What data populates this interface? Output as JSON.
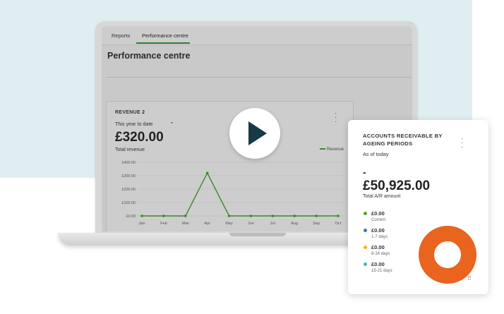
{
  "tabs": [
    {
      "label": "Reports"
    },
    {
      "label": "Performance centre",
      "active": true
    }
  ],
  "page_title": "Performance centre",
  "revenue_card": {
    "label": "REVENUE 2",
    "period": "This year to date",
    "amount": "£320.00",
    "subtitle": "Total revenue",
    "legend": "Revenue",
    "series_color": "#3a8a2a"
  },
  "chart_data": {
    "type": "line",
    "categories": [
      "Jan",
      "Feb",
      "Mar",
      "Apr",
      "May",
      "Jun",
      "Jul",
      "Aug",
      "Sep",
      "Oct"
    ],
    "series": [
      {
        "name": "Revenue",
        "values": [
          0,
          0,
          0,
          320,
          0,
          0,
          0,
          0,
          0,
          0
        ]
      }
    ],
    "y_ticks": [
      "£400.00",
      "£300.00",
      "£200.00",
      "£100.00",
      "£0.00"
    ],
    "ylim": [
      0,
      400
    ],
    "grid": true,
    "legend_position": "top-right"
  },
  "play_button": {
    "icon": "play-icon"
  },
  "ar_card": {
    "title": "ACCOUNTS RECEIVABLE BY AGEING PERIODS",
    "as_of": "As of today",
    "dash": "-",
    "amount": "£50,925.00",
    "subtitle": "Total A/R amount",
    "items": [
      {
        "value": "£0.00",
        "period": "Current",
        "color": "#5aa02c"
      },
      {
        "value": "£0.00",
        "period": "1-7 days",
        "color": "#2f7dc3"
      },
      {
        "value": "£0.00",
        "period": "8-14 days",
        "color": "#f2b31c"
      },
      {
        "value": "£0.00",
        "period": "15-21 days",
        "color": "#3bbfb0"
      }
    ],
    "donut_color": "#e9641f"
  }
}
